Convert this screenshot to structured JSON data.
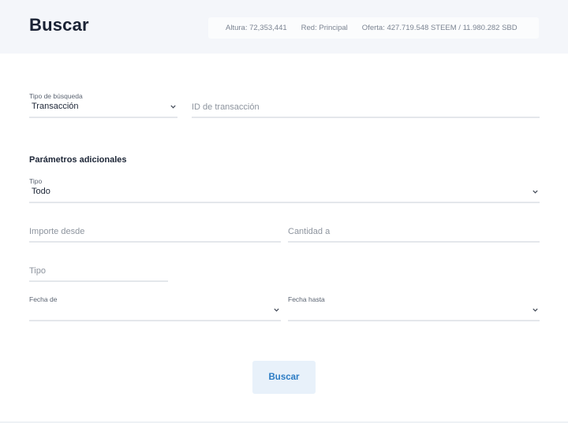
{
  "header": {
    "title": "Buscar",
    "stats": {
      "height": "Altura: 72,353,441",
      "network": "Red: Principal",
      "supply": "Oferta: 427.719.548 STEEM / 11.980.282 SBD"
    }
  },
  "search": {
    "type_label": "Tipo de búsqueda",
    "type_value": "Transacción",
    "tx_id_placeholder": "ID de transacción"
  },
  "additional": {
    "title": "Parámetros adicionales",
    "type_label": "Tipo",
    "type_value": "Todo",
    "amount_from_placeholder": "Importe desde",
    "amount_to_placeholder": "Cantidad a",
    "tipo_placeholder": "Tipo",
    "date_from_label": "Fecha de",
    "date_to_label": "Fecha hasta"
  },
  "actions": {
    "search_label": "Buscar"
  },
  "icons": {
    "dropdown": "chevron-down-icon"
  },
  "colors": {
    "header_bg": "#f4f6fa",
    "button_bg": "#e8f1fa",
    "button_text": "#2a7bc4"
  }
}
